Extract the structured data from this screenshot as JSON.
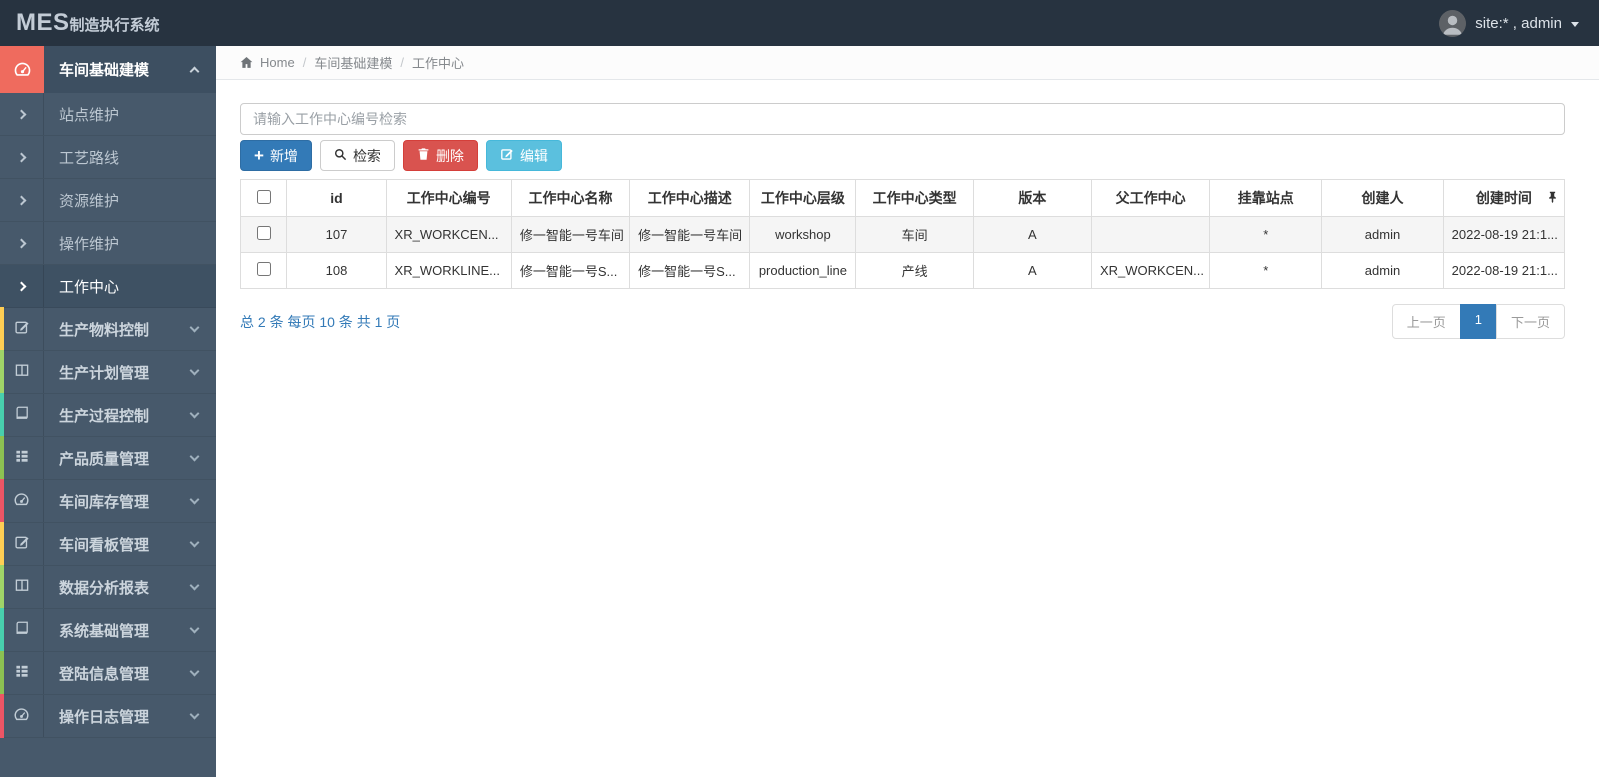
{
  "topbar": {
    "logo_mes": "MES",
    "logo_suffix": "制造执行系统",
    "user": "site:* , admin"
  },
  "breadcrumb": {
    "home": "Home",
    "items": [
      "车间基础建模",
      "工作中心"
    ]
  },
  "sidebar": {
    "group": {
      "label": "车间基础建模",
      "icon": "gauge-icon",
      "accent_color": "#ef6b5e"
    },
    "submenu": [
      {
        "label": "站点维护",
        "active": false
      },
      {
        "label": "工艺路线",
        "active": false
      },
      {
        "label": "资源维护",
        "active": false
      },
      {
        "label": "操作维护",
        "active": false
      },
      {
        "label": "工作中心",
        "active": true
      }
    ],
    "items": [
      {
        "label": "生产物料控制",
        "icon": "pencil-square-icon",
        "strip_color": "#ffce54"
      },
      {
        "label": "生产计划管理",
        "icon": "columns-icon",
        "strip_color": "#a0d468"
      },
      {
        "label": "生产过程控制",
        "icon": "book-icon",
        "strip_color": "#48cfad"
      },
      {
        "label": "产品质量管理",
        "icon": "list-icon",
        "strip_color": "#8cc152"
      },
      {
        "label": "车间库存管理",
        "icon": "gauge-icon",
        "strip_color": "#ed5565"
      },
      {
        "label": "车间看板管理",
        "icon": "pencil-square-icon",
        "strip_color": "#ffce54"
      },
      {
        "label": "数据分析报表",
        "icon": "columns-icon",
        "strip_color": "#a0d468"
      },
      {
        "label": "系统基础管理",
        "icon": "book-icon",
        "strip_color": "#48cfad"
      },
      {
        "label": "登陆信息管理",
        "icon": "list-icon",
        "strip_color": "#8cc152"
      },
      {
        "label": "操作日志管理",
        "icon": "gauge-icon",
        "strip_color": "#ed5565"
      }
    ]
  },
  "toolbar": {
    "search_placeholder": "请输入工作中心编号检索",
    "add_label": "新增",
    "search_label": "检索",
    "delete_label": "删除",
    "edit_label": "编辑"
  },
  "table": {
    "headers": [
      "id",
      "工作中心编号",
      "工作中心名称",
      "工作中心描述",
      "工作中心层级",
      "工作中心类型",
      "版本",
      "父工作中心",
      "挂靠站点",
      "创建人",
      "创建时间"
    ],
    "rows": [
      [
        "107",
        "XR_WORKCEN...",
        "修一智能一号车间",
        "修一智能一号车间",
        "workshop",
        "车间",
        "A",
        "",
        "*",
        "admin",
        "2022-08-19 21:1..."
      ],
      [
        "108",
        "XR_WORKLINE...",
        "修一智能一号S...",
        "修一智能一号S...",
        "production_line",
        "产线",
        "A",
        "XR_WORKCEN...",
        "*",
        "admin",
        "2022-08-19 21:1..."
      ]
    ]
  },
  "pagination": {
    "summary": "总 2 条  每页 10 条  共 1 页",
    "prev_label": "上一页",
    "current_page": "1",
    "next_label": "下一页"
  },
  "colors": {
    "topbar_bg": "#273340",
    "sidebar_bg": "#47596b",
    "sidebar_active_bg": "#3e5163",
    "sidebar_accent": "#ef6b5e",
    "primary": "#337ab7",
    "danger": "#d9534f",
    "info": "#5bc0de",
    "link_blue": "#337ab7"
  }
}
